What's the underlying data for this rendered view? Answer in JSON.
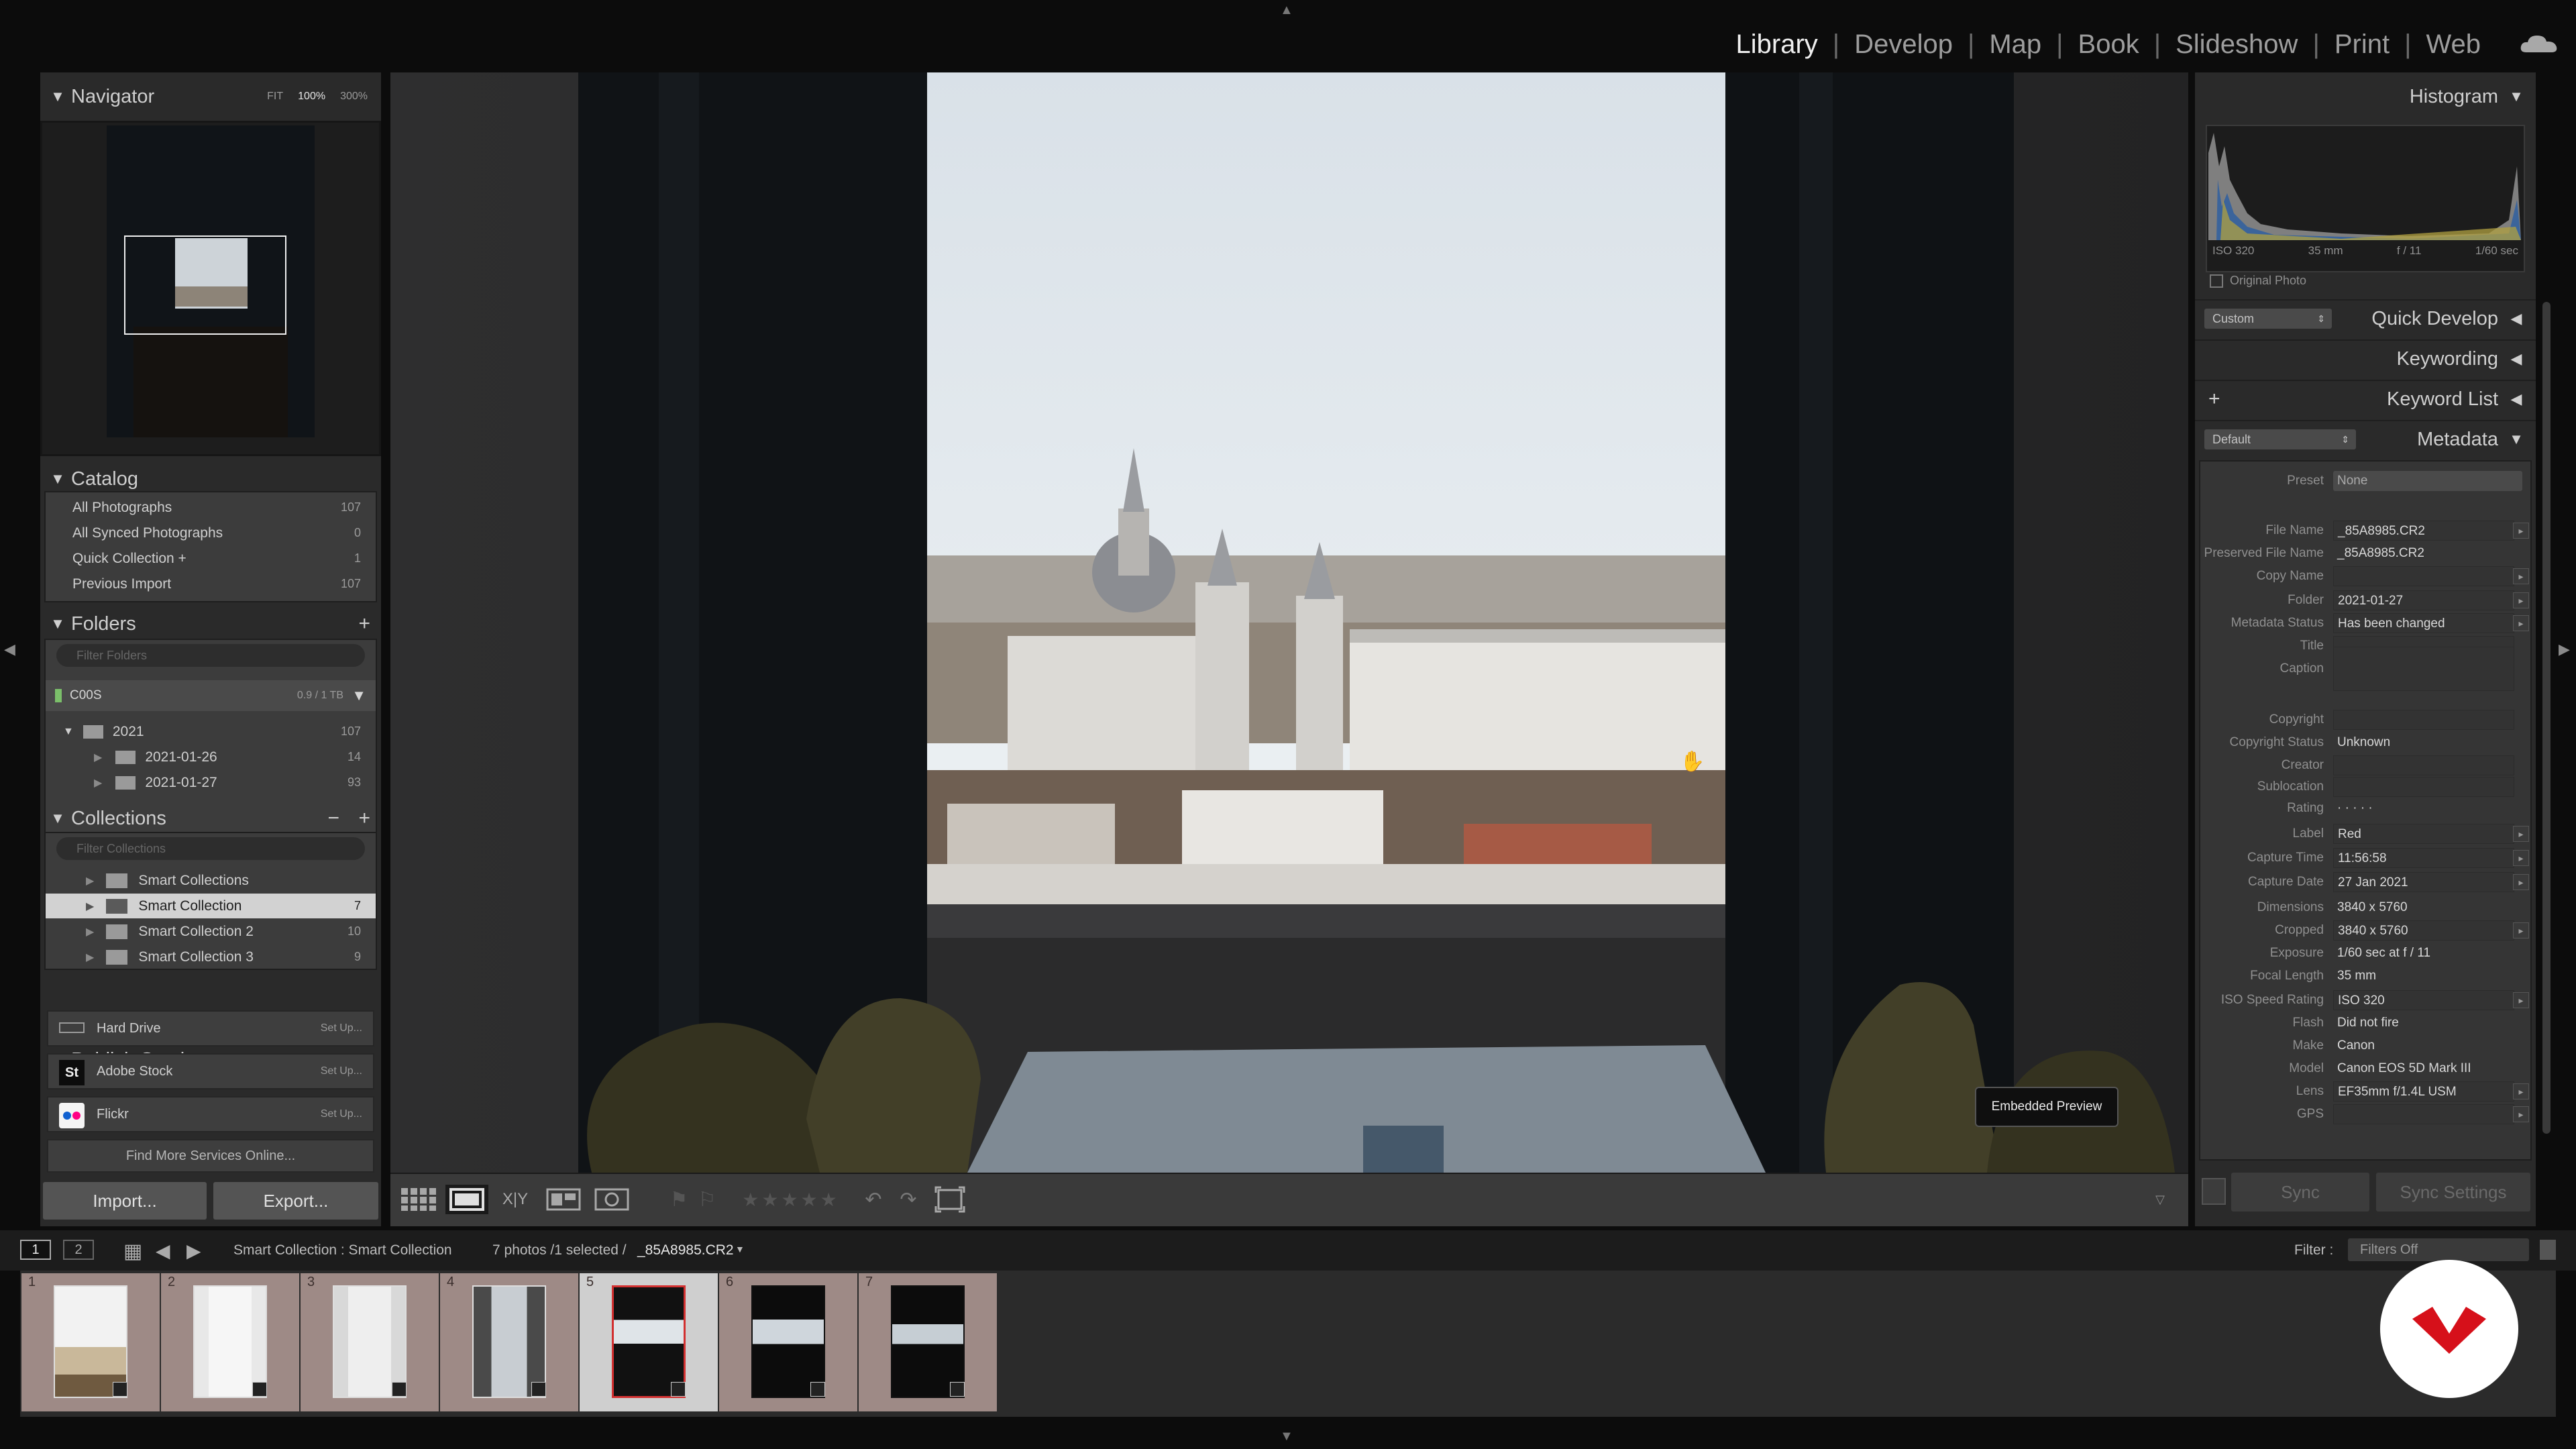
{
  "modules": [
    "Library",
    "Develop",
    "Map",
    "Book",
    "Slideshow",
    "Print",
    "Web"
  ],
  "active_module": "Library",
  "navigator": {
    "title": "Navigator",
    "zoom": [
      "FIT",
      "100%",
      "300%"
    ]
  },
  "catalog": {
    "title": "Catalog",
    "items": [
      {
        "label": "All Photographs",
        "count": "107"
      },
      {
        "label": "All Synced Photographs",
        "count": "0"
      },
      {
        "label": "Quick Collection +",
        "count": "1"
      },
      {
        "label": "Previous Import",
        "count": "107"
      }
    ]
  },
  "folders": {
    "title": "Folders",
    "filter_placeholder": "Filter Folders",
    "volume": {
      "name": "C00S",
      "usage": "0.9 / 1 TB"
    },
    "items": [
      {
        "label": "2021",
        "count": "107"
      },
      {
        "label": "2021-01-26",
        "count": "14"
      },
      {
        "label": "2021-01-27",
        "count": "93"
      }
    ]
  },
  "collections": {
    "title": "Collections",
    "filter_placeholder": "Filter Collections",
    "items": [
      {
        "label": "Smart Collections",
        "count": ""
      },
      {
        "label": "Smart Collection",
        "count": "7"
      },
      {
        "label": "Smart Collection 2",
        "count": "10"
      },
      {
        "label": "Smart Collection 3",
        "count": "9"
      }
    ]
  },
  "publish": {
    "title": "Publish Services",
    "services": [
      {
        "label": "Hard Drive",
        "action": "Set Up..."
      },
      {
        "label": "Adobe Stock",
        "action": "Set Up..."
      },
      {
        "label": "Flickr",
        "action": "Set Up..."
      }
    ],
    "find_more": "Find More Services Online..."
  },
  "buttons": {
    "import": "Import...",
    "export": "Export..."
  },
  "histogram": {
    "title": "Histogram",
    "iso": "ISO 320",
    "focal": "35 mm",
    "aperture": "f / 11",
    "shutter": "1/60 sec",
    "original_photo": "Original Photo"
  },
  "right_sections": {
    "quick_develop": "Quick Develop",
    "quick_develop_preset": "Custom",
    "keywording": "Keywording",
    "keyword_list": "Keyword List",
    "metadata": "Metadata",
    "metadata_preset": "Default"
  },
  "metadata": {
    "preset_label": "Preset",
    "preset_value": "None",
    "rows": [
      {
        "label": "File Name",
        "value": "_85A8985.CR2"
      },
      {
        "label": "Preserved File Name",
        "value": "_85A8985.CR2"
      },
      {
        "label": "Copy Name",
        "value": ""
      },
      {
        "label": "Folder",
        "value": "2021-01-27"
      },
      {
        "label": "Metadata Status",
        "value": "Has been changed"
      },
      {
        "label": "Title",
        "value": ""
      },
      {
        "label": "Caption",
        "value": ""
      },
      {
        "label": "Copyright",
        "value": ""
      },
      {
        "label": "Copyright Status",
        "value": "Unknown"
      },
      {
        "label": "Creator",
        "value": ""
      },
      {
        "label": "Sublocation",
        "value": ""
      },
      {
        "label": "Rating",
        "value": "· · · · ·"
      },
      {
        "label": "Label",
        "value": "Red"
      },
      {
        "label": "Capture Time",
        "value": "11:56:58"
      },
      {
        "label": "Capture Date",
        "value": "27 Jan 2021"
      },
      {
        "label": "Dimensions",
        "value": "3840 x 5760"
      },
      {
        "label": "Cropped",
        "value": "3840 x 5760"
      },
      {
        "label": "Exposure",
        "value": "1/60 sec at f / 11"
      },
      {
        "label": "Focal Length",
        "value": "35 mm"
      },
      {
        "label": "ISO Speed Rating",
        "value": "ISO 320"
      },
      {
        "label": "Flash",
        "value": "Did not fire"
      },
      {
        "label": "Make",
        "value": "Canon"
      },
      {
        "label": "Model",
        "value": "Canon EOS 5D Mark III"
      },
      {
        "label": "Lens",
        "value": "EF35mm f/1.4L USM"
      },
      {
        "label": "GPS",
        "value": ""
      }
    ]
  },
  "sync": {
    "sync": "Sync",
    "sync_settings": "Sync Settings"
  },
  "tooltip": "Embedded Preview",
  "filmstrip": {
    "monitor1": "1",
    "monitor2": "2",
    "breadcrumb": "Smart Collection : Smart Collection",
    "count": "7 photos /1 selected /",
    "filename": "_85A8985.CR2",
    "filter_label": "Filter :",
    "filter_value": "Filters Off",
    "thumbs": [
      "1",
      "2",
      "3",
      "4",
      "5",
      "6",
      "7"
    ],
    "selected_index": 5
  },
  "icons": {
    "cloud": "cloud-icon",
    "logo": "brand-logo"
  }
}
